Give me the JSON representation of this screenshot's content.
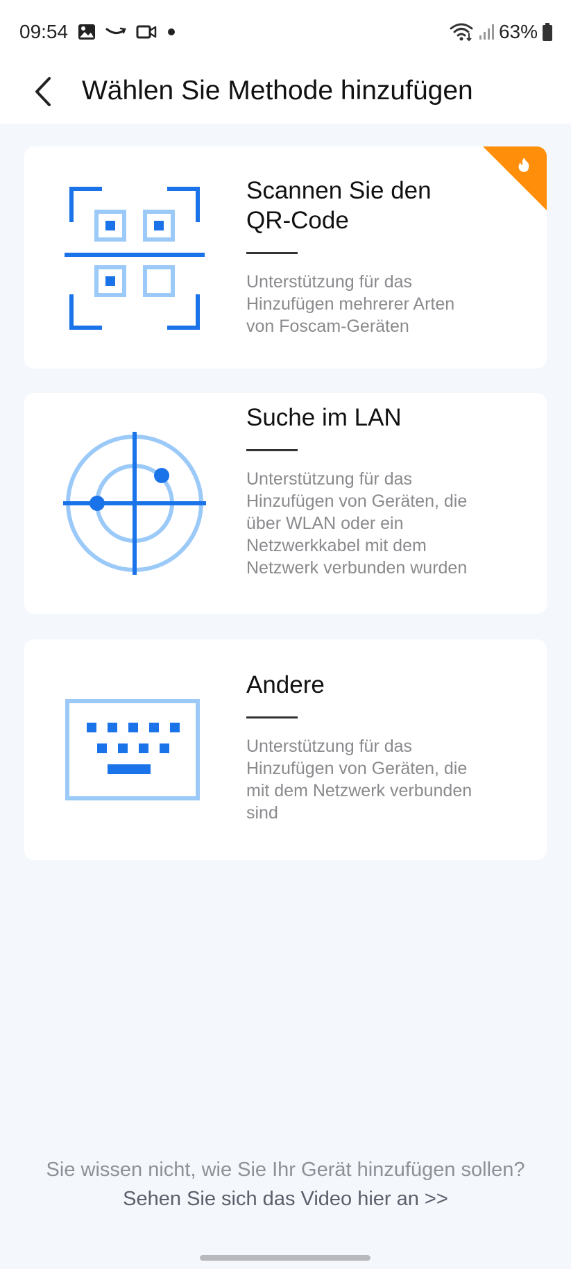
{
  "status_bar": {
    "time": "09:54",
    "battery": "63%",
    "icons": [
      "gallery-icon",
      "amazon-icon",
      "video-camera-icon",
      "dot-icon",
      "wifi-icon",
      "signal-icon",
      "battery-icon"
    ]
  },
  "header": {
    "title": "Wählen Sie Methode hinzufügen",
    "back_icon": "chevron-left-icon"
  },
  "methods": [
    {
      "title": "Scannen Sie den QR-Code",
      "description": "Unterstützung für das Hinzufügen mehrerer Arten von Foscam-Geräten",
      "icon": "qr-scan-icon",
      "badge": "fire-icon"
    },
    {
      "title": "Suche im LAN",
      "description": "Unterstützung für das Hinzufügen von Geräten, die über WLAN oder ein Netzwerkkabel mit dem Netzwerk verbunden wurden",
      "icon": "radar-icon"
    },
    {
      "title": "Andere",
      "description": "Unterstützung für das Hinzufügen von Geräten, die mit dem Netzwerk verbunden sind",
      "icon": "keyboard-icon"
    }
  ],
  "footer": {
    "hint": "Sie wissen nicht, wie Sie Ihr Gerät hinzufügen sollen?",
    "link": "Sehen Sie sich das Video hier an >>"
  },
  "colors": {
    "accent_blue": "#1a73e8",
    "light_blue": "#9ccaf8",
    "badge_orange": "#ff8f0a",
    "background": "#f4f7fc"
  }
}
